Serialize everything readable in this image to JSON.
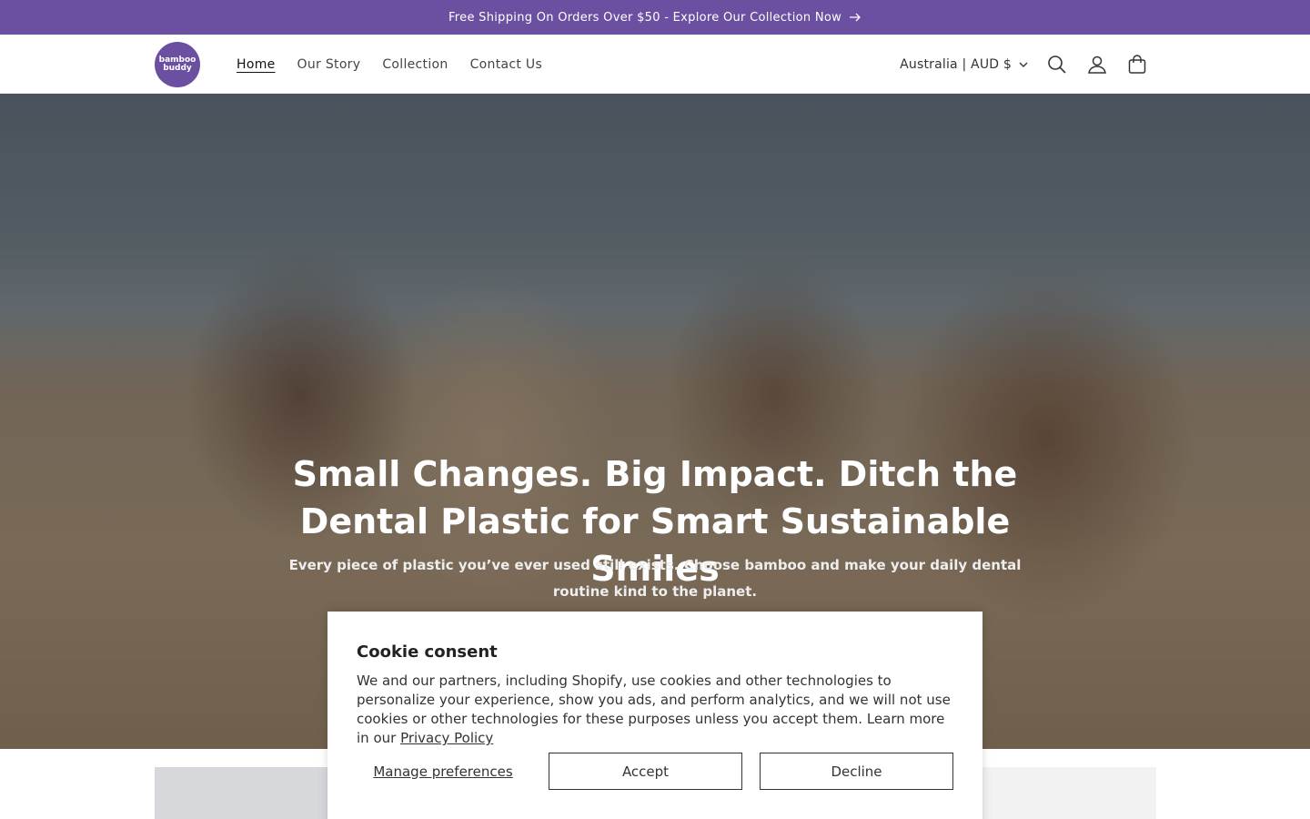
{
  "announcement": {
    "text": "Free Shipping On Orders Over $50 - Explore Our Collection Now",
    "icon": "arrow-right-icon"
  },
  "header": {
    "logo": {
      "line1": "bamboo",
      "line2": "buddy",
      "color": "#6b4fa0"
    },
    "nav": [
      {
        "label": "Home",
        "active": true
      },
      {
        "label": "Our Story",
        "active": false
      },
      {
        "label": "Collection",
        "active": false
      },
      {
        "label": "Contact Us",
        "active": false
      }
    ],
    "country_selector": "Australia | AUD $",
    "icons": [
      "search-icon",
      "account-icon",
      "cart-icon"
    ]
  },
  "hero": {
    "title": "Small Changes. Big Impact. Ditch the Dental Plastic for Smart Sustainable Smiles",
    "subtitle": "Every piece of plastic you’ve ever used still exists. Choose bamboo and make your daily dental routine kind to the planet."
  },
  "cookie": {
    "title": "Cookie consent",
    "body": "We and our partners, including Shopify, use cookies and other technologies to personalize your experience, show you ads, and perform analytics, and we will not use cookies or other technologies for these purposes unless you accept them. Learn more in our ",
    "link": "Privacy Policy",
    "manage_label": "Manage preferences",
    "accept_label": "Accept",
    "decline_label": "Decline"
  },
  "colors": {
    "brand": "#6b4fa0"
  }
}
